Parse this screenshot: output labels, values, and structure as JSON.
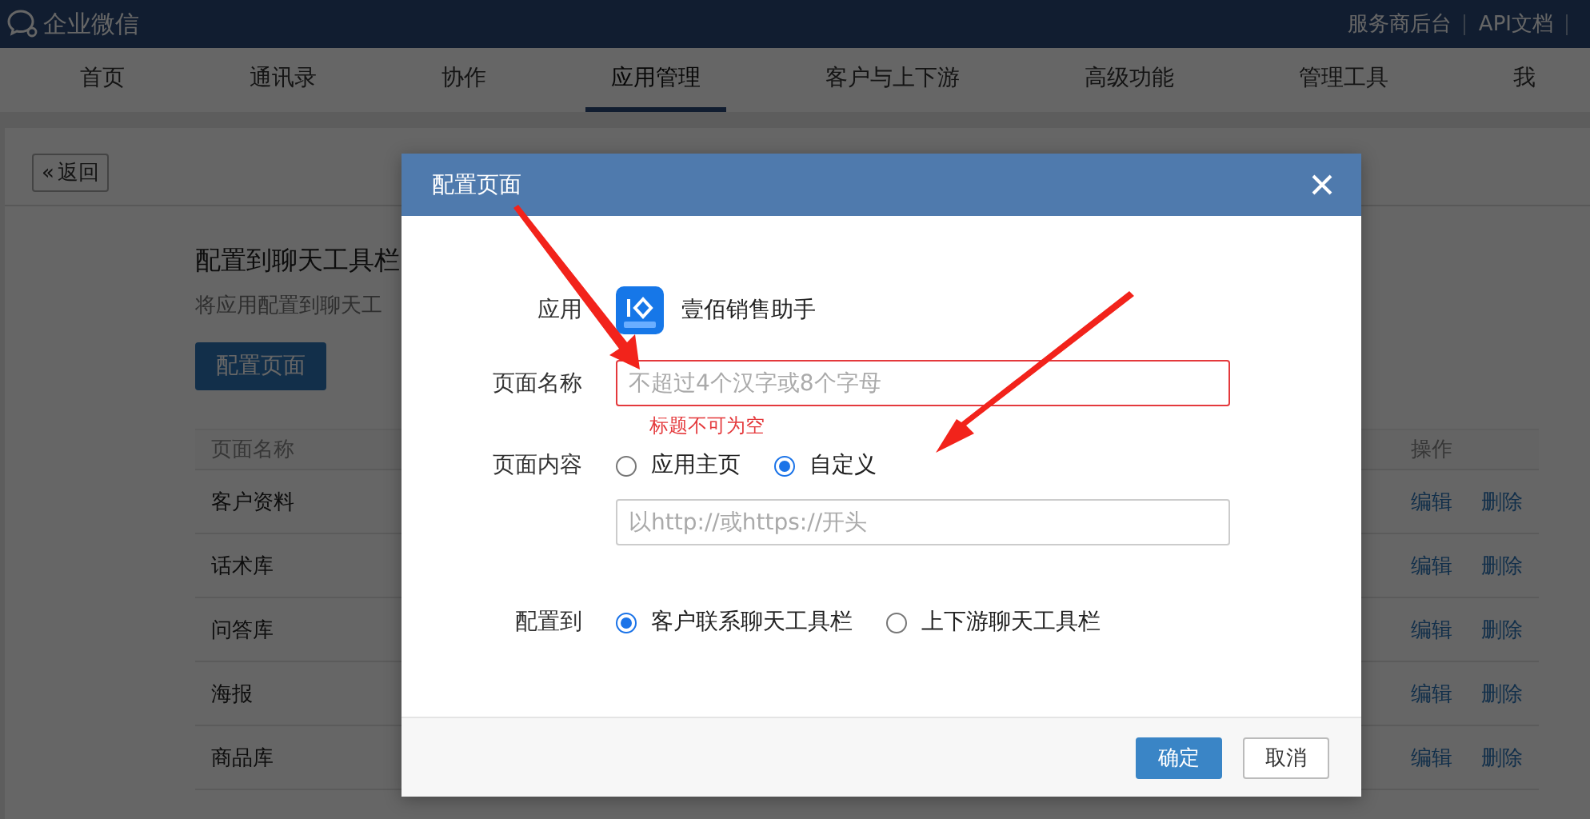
{
  "topbar": {
    "logo_text": "企业微信",
    "links": [
      "服务商后台",
      "API文档"
    ]
  },
  "nav": {
    "tabs": [
      {
        "label": "首页",
        "selected": false
      },
      {
        "label": "通讯录",
        "selected": false
      },
      {
        "label": "协作",
        "selected": false
      },
      {
        "label": "应用管理",
        "selected": true
      },
      {
        "label": "客户与上下游",
        "selected": false
      },
      {
        "label": "高级功能",
        "selected": false
      },
      {
        "label": "管理工具",
        "selected": false
      },
      {
        "label": "我",
        "selected": false
      }
    ]
  },
  "page": {
    "back_button": {
      "icon": "«",
      "label": "返回"
    },
    "section_title": "配置到聊天工具栏",
    "section_desc": "将应用配置到聊天工",
    "config_button": "配置页面",
    "table": {
      "columns": [
        "页面名称",
        "操作"
      ],
      "rows": [
        {
          "name": "客户资料",
          "actions": [
            "编辑",
            "删除"
          ]
        },
        {
          "name": "话术库",
          "actions": [
            "编辑",
            "删除"
          ]
        },
        {
          "name": "问答库",
          "actions": [
            "编辑",
            "删除"
          ]
        },
        {
          "name": "海报",
          "actions": [
            "编辑",
            "删除"
          ]
        },
        {
          "name": "商品库",
          "actions": [
            "编辑",
            "删除"
          ]
        }
      ]
    }
  },
  "dialog": {
    "title": "配置页面",
    "app": {
      "label": "应用",
      "name": "壹佰销售助手"
    },
    "page_name": {
      "label": "页面名称",
      "placeholder": "不超过4个汉字或8个字母",
      "error": "标题不可为空"
    },
    "page_content": {
      "label": "页面内容",
      "options": [
        {
          "label": "应用主页",
          "selected": false
        },
        {
          "label": "自定义",
          "selected": true
        }
      ],
      "url_placeholder": "以http://或https://开头"
    },
    "target": {
      "label": "配置到",
      "options": [
        {
          "label": "客户联系聊天工具栏",
          "selected": true
        },
        {
          "label": "上下游聊天工具栏",
          "selected": false
        }
      ]
    },
    "buttons": [
      {
        "label": "确定",
        "kind": "primary"
      },
      {
        "label": "取消",
        "kind": "default"
      }
    ]
  }
}
